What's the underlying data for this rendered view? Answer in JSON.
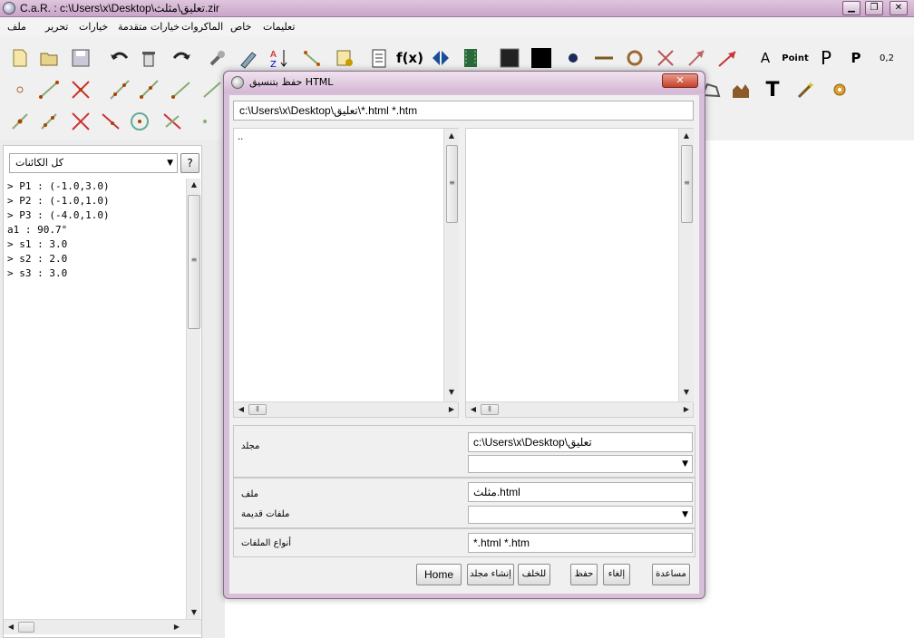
{
  "window": {
    "title": "C.a.R. : c:\\Users\\x\\Desktop\\تعليق\\مثلث.zir",
    "minimize": "▁",
    "maximize": "❐",
    "close": "✕"
  },
  "menu": [
    "ملف",
    "تحرير",
    "خيارات",
    "خيارات متقدمة",
    "الماكروات",
    "خاص",
    "تعليمات"
  ],
  "toolbar": {
    "fx_label": "f(x)",
    "point_label": "Point",
    "p_label": "P",
    "p_small_label": "P",
    "coord_label": "0,2",
    "text_label": "T",
    "a_label": "A"
  },
  "left_panel": {
    "filter_value": "كل الكائنات",
    "help_label": "?",
    "objects": [
      "> P1 : (-1.0,3.0)",
      "> P2 : (-1.0,1.0)",
      "> P3 : (-4.0,1.0)",
      "a1 : 90.7°",
      "> s1 : 3.0",
      "> s2 : 2.0",
      "> s3 : 3.0"
    ]
  },
  "dialog": {
    "title": "حفظ بتنسيق  HTML",
    "path": "c:\\Users\\x\\Desktop\\تعليق\\*.html *.htm",
    "dir_entry": "..",
    "folder_label": "مجلد",
    "folder_value": "c:\\Users\\x\\Desktop\\تعليق",
    "file_label": "ملف",
    "file_value": "مثلث.html",
    "old_files_label": "ملفات قديمة",
    "types_label": "أنواع الملفات",
    "types_value": "*.html *.htm",
    "buttons": {
      "home": "Home",
      "new_folder": "إنشاء مجلد",
      "back": "للخلف",
      "save": "حفظ",
      "cancel": "إلغاء",
      "help": "مساعدة"
    }
  }
}
